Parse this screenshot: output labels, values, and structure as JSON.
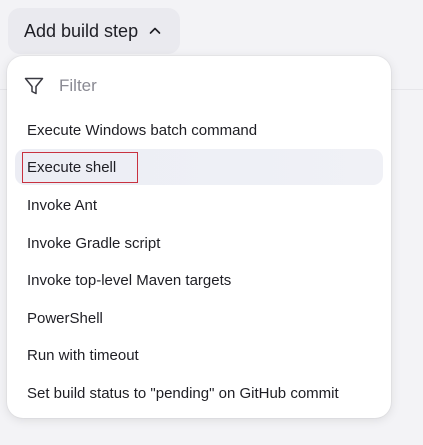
{
  "add_step_button": {
    "label": "Add build step"
  },
  "filter": {
    "placeholder": "Filter",
    "value": ""
  },
  "menu": {
    "items": [
      {
        "label": "Execute Windows batch command"
      },
      {
        "label": "Execute shell"
      },
      {
        "label": "Invoke Ant"
      },
      {
        "label": "Invoke Gradle script"
      },
      {
        "label": "Invoke top-level Maven targets"
      },
      {
        "label": "PowerShell"
      },
      {
        "label": "Run with timeout"
      },
      {
        "label": "Set build status to \"pending\" on GitHub commit"
      }
    ]
  },
  "icons": {
    "filter": "filter-icon",
    "chevron": "chevron-up-icon"
  },
  "colors": {
    "focus_outline": "#c8313f",
    "hover_background": "#eef0f6",
    "text": "#1e1e24",
    "placeholder": "#8a8a93"
  }
}
